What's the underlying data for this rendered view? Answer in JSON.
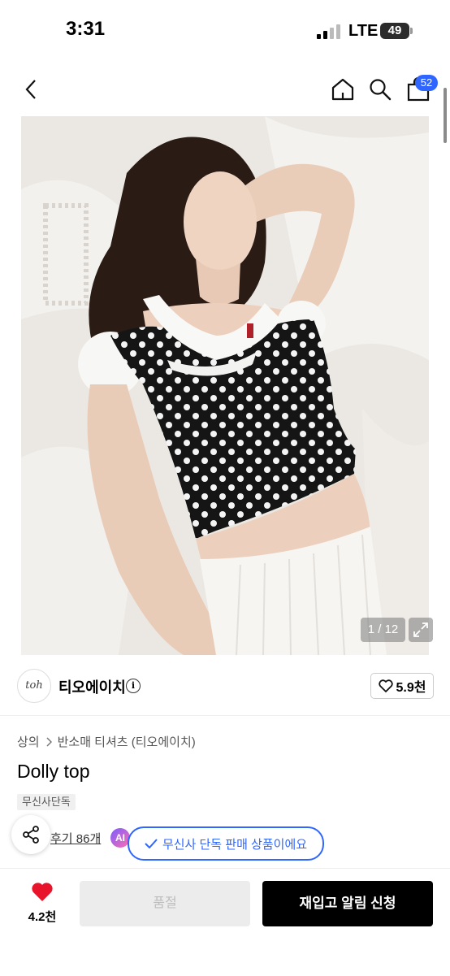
{
  "status_bar": {
    "time": "3:31",
    "network": "LTE",
    "battery": "49"
  },
  "nav": {
    "cart_count": "52"
  },
  "gallery": {
    "counter": "1 / 12"
  },
  "brand": {
    "logo_text": "toh",
    "name": "티오에이치",
    "likes": "5.9천"
  },
  "breadcrumb": [
    "상의",
    "반소매 티셔츠 (티오에이치)"
  ],
  "product": {
    "title": "Dolly top",
    "tag": "무신사단독"
  },
  "review": {
    "label": "후기 86개",
    "ai_badge": "AI"
  },
  "tooltip": {
    "text": "무신사 단독 판매 상품이에요"
  },
  "bottom": {
    "like_count": "4.2천",
    "soldout_label": "품절",
    "restock_label": "재입고 알림 신청"
  },
  "colors": {
    "accent": "#2f66ff",
    "heart": "#e8142b",
    "primary_button": "#000000"
  }
}
